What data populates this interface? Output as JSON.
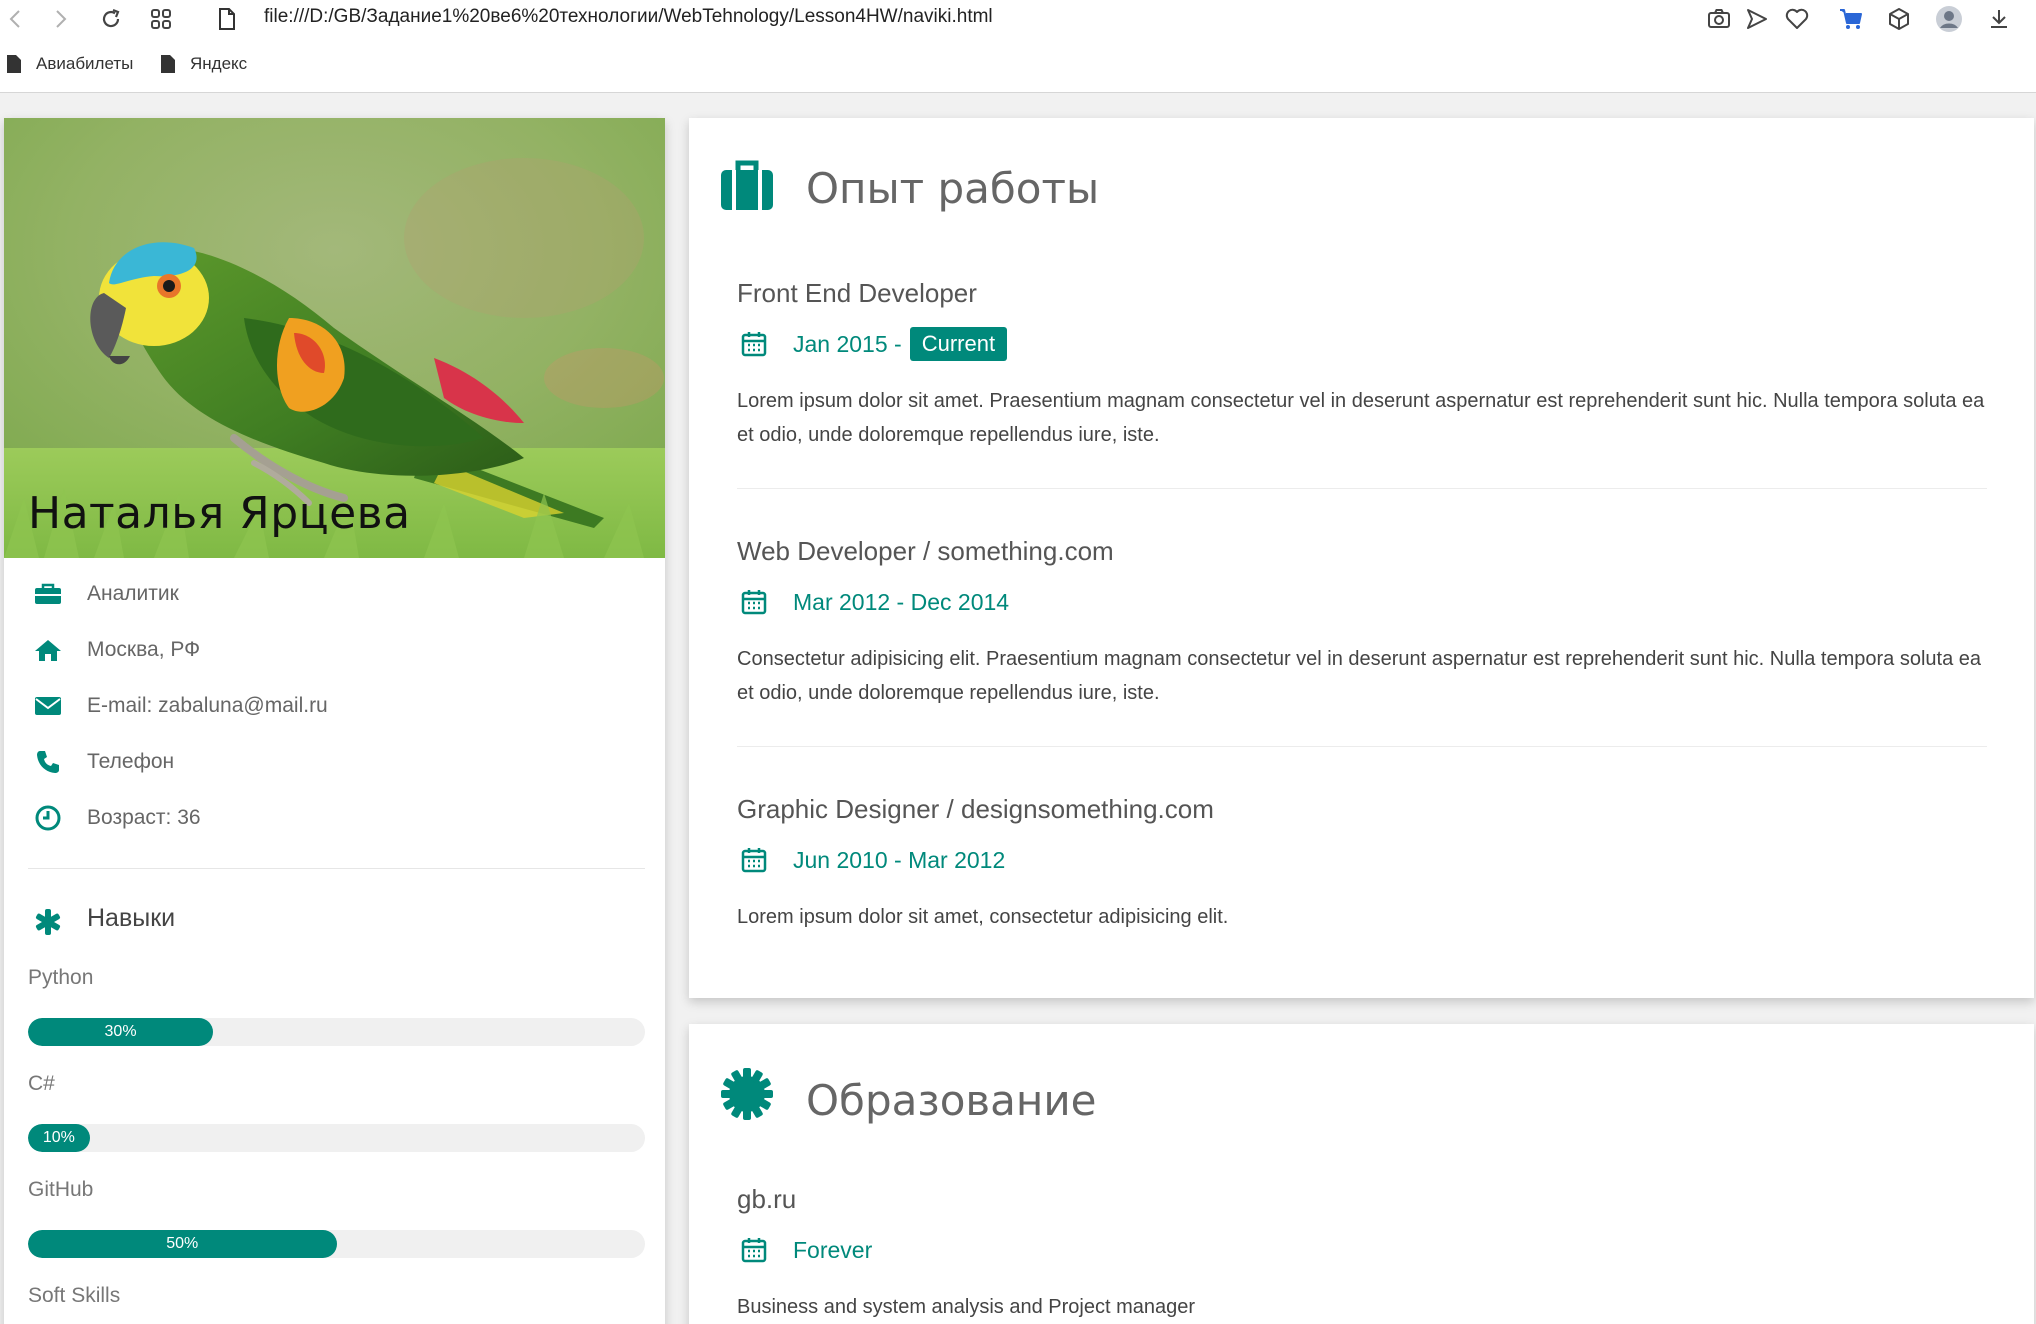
{
  "browser": {
    "url": "file:///D:/GB/Задание1%20ве6%20технологии/WebTehnology/Lesson4HW/naviki.html",
    "bookmarks": [
      "Авиабилеты",
      "Яндекс"
    ]
  },
  "profile": {
    "name": "Наталья Ярцева",
    "info": [
      {
        "icon": "briefcase-icon",
        "text": "Аналитик"
      },
      {
        "icon": "home-icon",
        "text": "Москва, РФ"
      },
      {
        "icon": "envelope-icon",
        "text": "E-mail: zabaluna@mail.ru"
      },
      {
        "icon": "phone-icon",
        "text": "Телефон"
      },
      {
        "icon": "clock-icon",
        "text": "Возраст: 36"
      }
    ]
  },
  "skills": {
    "title": "Навыки",
    "items": [
      {
        "name": "Python",
        "percent": 30,
        "label": "30%"
      },
      {
        "name": "C#",
        "percent": 10,
        "label": "10%"
      },
      {
        "name": "GitHub",
        "percent": 50,
        "label": "50%"
      },
      {
        "name": "Soft Skills"
      }
    ]
  },
  "experience": {
    "title": "Опыт работы",
    "jobs": [
      {
        "title": "Front End Developer",
        "date": "Jan 2015 -",
        "badge": "Current",
        "description": "Lorem ipsum dolor sit amet. Praesentium magnam consectetur vel in deserunt aspernatur est reprehenderit sunt hic. Nulla tempora soluta ea et odio, unde doloremque repellendus iure, iste."
      },
      {
        "title": "Web Developer / something.com",
        "date": "Mar 2012 - Dec 2014",
        "description": "Consectetur adipisicing elit. Praesentium magnam consectetur vel in deserunt aspernatur est reprehenderit sunt hic. Nulla tempora soluta ea et odio, unde doloremque repellendus iure, iste."
      },
      {
        "title": "Graphic Designer / designsomething.com",
        "date": "Jun 2010 - Mar 2012",
        "description": "Lorem ipsum dolor sit amet, consectetur adipisicing elit."
      }
    ]
  },
  "education": {
    "title": "Образование",
    "items": [
      {
        "title": "gb.ru",
        "date": "Forever",
        "description": "Business and system analysis and Project manager"
      }
    ]
  },
  "colors": {
    "accent": "#00897b",
    "background": "#f1f1f1"
  }
}
